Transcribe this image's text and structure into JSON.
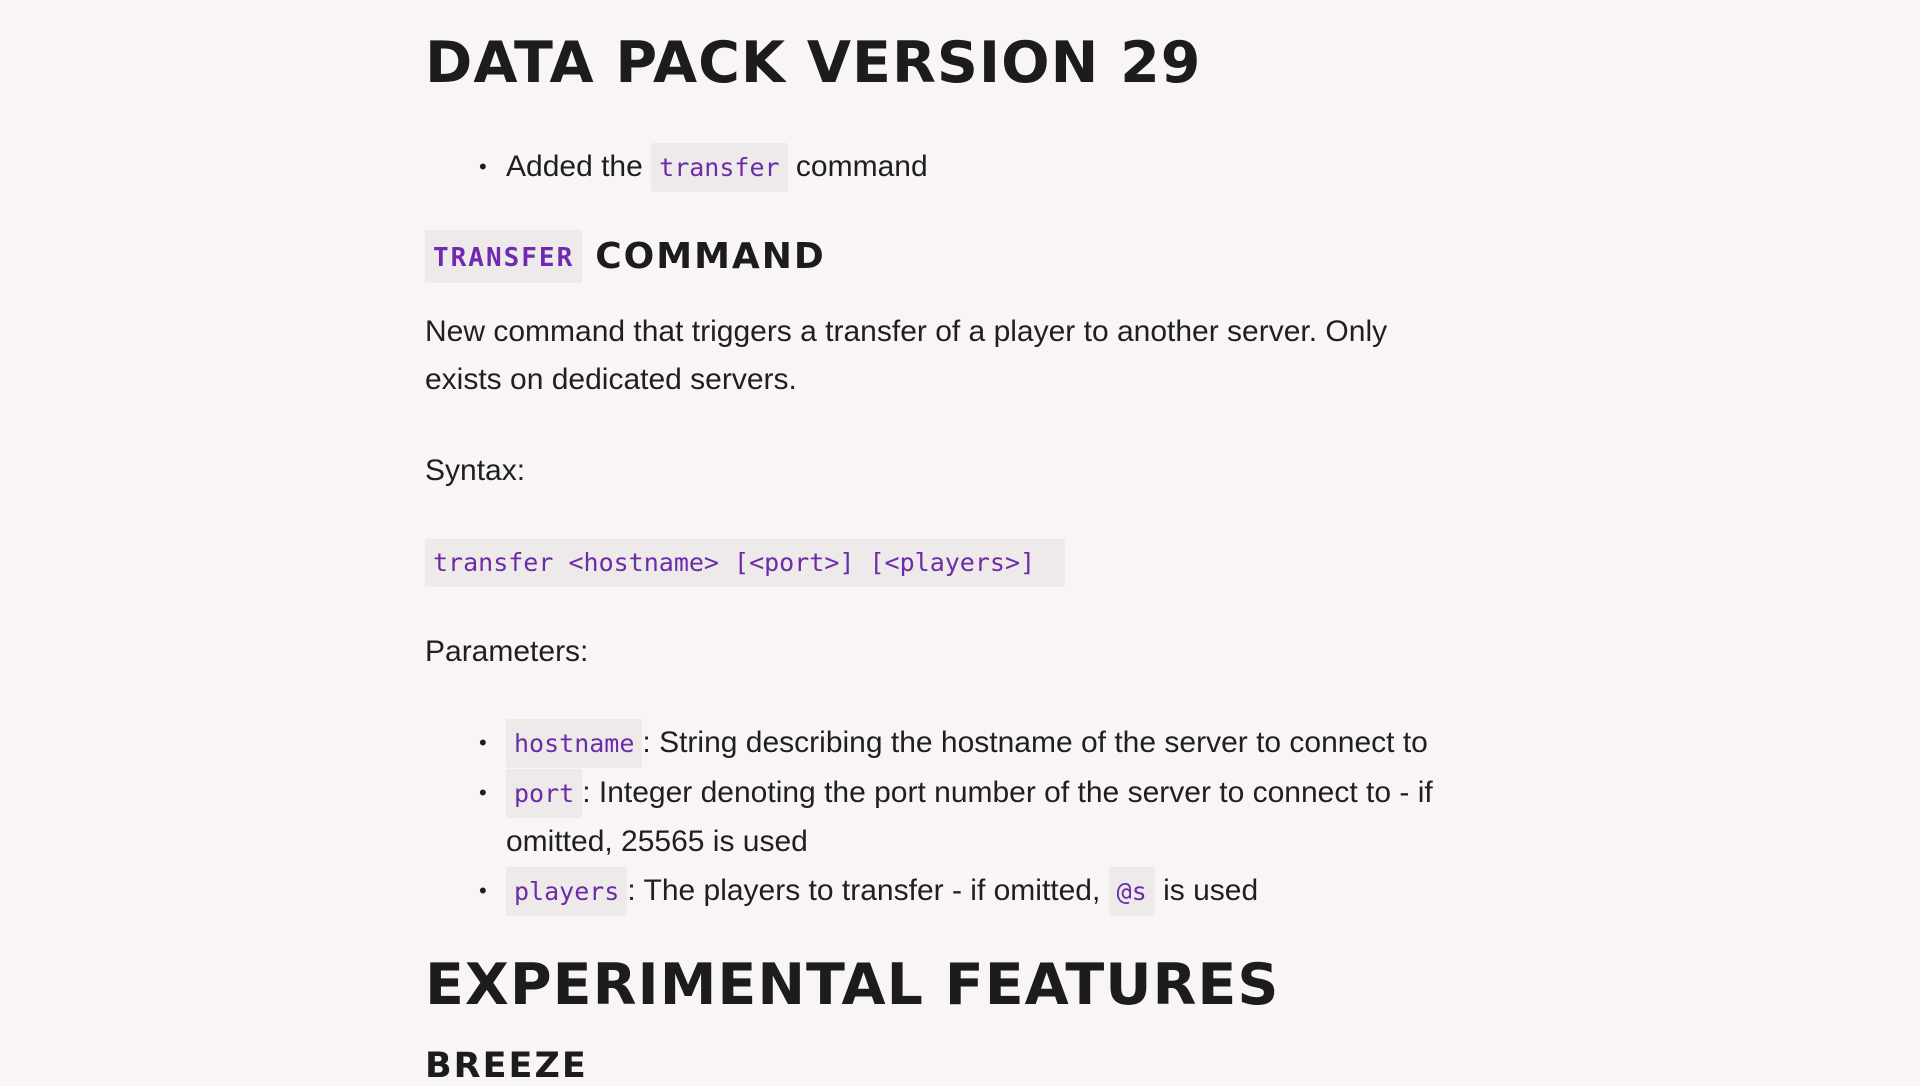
{
  "sections": {
    "title": "DATA PACK VERSION 29",
    "summary_list": [
      {
        "before": "Added the",
        "code": "transfer",
        "after": "command"
      }
    ],
    "command_heading": {
      "code": "TRANSFER",
      "text": "COMMAND"
    },
    "description_line1": "New command that triggers a transfer of a player to another server. Only",
    "description_line2": "exists on dedicated servers.",
    "syntax_label": "Syntax:",
    "syntax_code": "transfer <hostname> [<port>] [<players>]",
    "parameters_label": "Parameters:",
    "parameters": [
      {
        "name": "hostname",
        "text": ": String describing the hostname of the server to connect to"
      },
      {
        "name": "port",
        "text": ": Integer denoting the port number of the server to connect to - if",
        "text2": "omitted, 25565 is used"
      },
      {
        "name": "players",
        "text": ": The players to transfer - if omitted,",
        "code2": "@s",
        "text2": "is used"
      }
    ],
    "experimental_heading": "EXPERIMENTAL FEATURES",
    "breeze_heading": "BREEZE"
  },
  "bullet_glyph": "•",
  "colors": {
    "background": "#f8f5f4",
    "text": "#1f1f1f",
    "code_text": "#6c2bab",
    "code_background": "#eeeae9"
  }
}
